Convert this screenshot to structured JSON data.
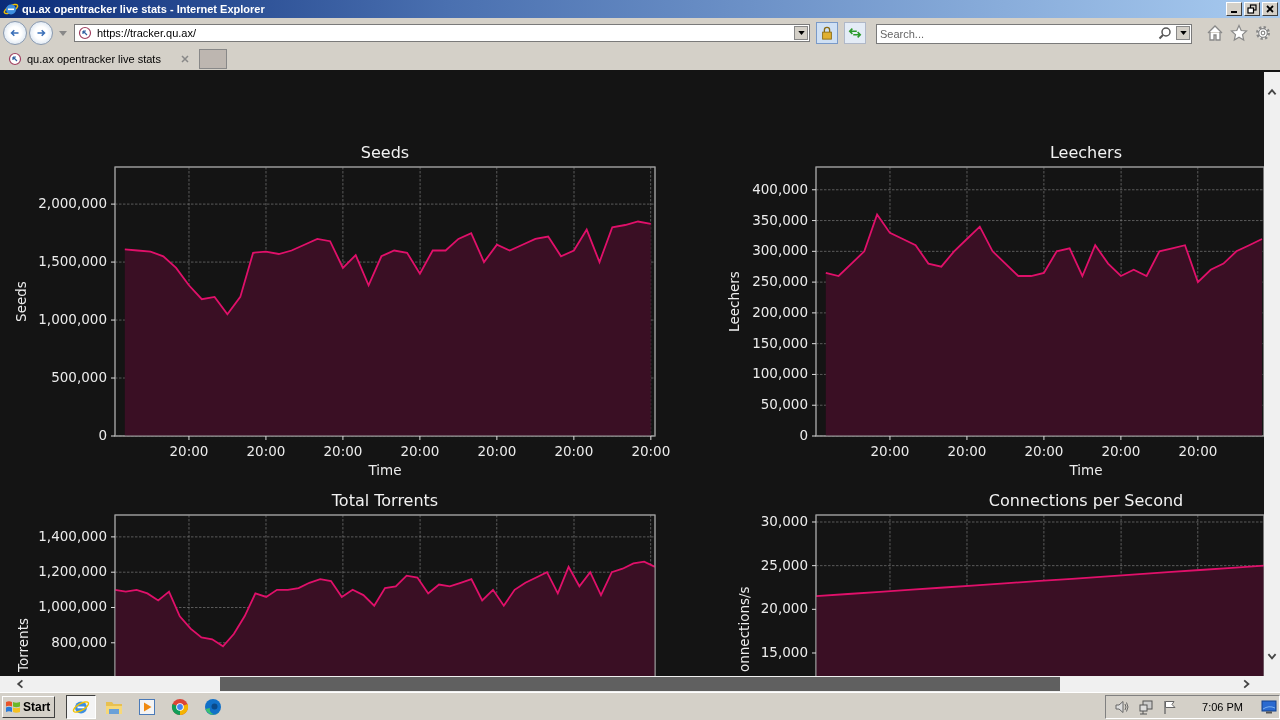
{
  "window": {
    "title": "qu.ax opentracker live stats - Internet Explorer"
  },
  "address_bar": {
    "url": "https://tracker.qu.ax/"
  },
  "search": {
    "placeholder": "Search..."
  },
  "tabs": [
    {
      "label": "qu.ax opentracker live stats",
      "selected": true
    }
  ],
  "panels": [
    {
      "chart_data": {
        "type": "area",
        "title": "Seeds",
        "xlabel": "Time",
        "ylabel": "Seeds",
        "grid": true,
        "ylim": [
          0,
          2320000
        ],
        "categories": [
          null,
          null,
          null,
          null,
          null,
          "20:00",
          null,
          null,
          null,
          null,
          null,
          "20:00",
          null,
          null,
          null,
          null,
          null,
          "20:00",
          null,
          null,
          null,
          null,
          null,
          "20:00",
          null,
          null,
          null,
          null,
          null,
          "20:00",
          null,
          null,
          null,
          null,
          null,
          "20:00",
          null,
          null,
          null,
          null,
          null,
          "20:00"
        ],
        "series": [
          {
            "color": "#e0106a",
            "values": [
              1610000,
              1600000,
              1590000,
              1550000,
              1450000,
              1300000,
              1180000,
              1200000,
              1050000,
              1200000,
              1580000,
              1590000,
              1570000,
              1600000,
              1650000,
              1700000,
              1680000,
              1450000,
              1560000,
              1300000,
              1550000,
              1600000,
              1580000,
              1400000,
              1600000,
              1600000,
              1700000,
              1750000,
              1500000,
              1650000,
              1600000,
              1650000,
              1700000,
              1720000,
              1550000,
              1600000,
              1780000,
              1500000,
              1800000,
              1820000,
              1850000,
              1830000
            ]
          }
        ],
        "yticks": [
          {
            "value": 0,
            "label": "0"
          },
          {
            "value": 500000,
            "label": "500,000"
          },
          {
            "value": 1000000,
            "label": "1,000,000"
          },
          {
            "value": 1500000,
            "label": "1,500,000"
          },
          {
            "value": 2000000,
            "label": "2,000,000"
          }
        ]
      }
    },
    {
      "chart_data": {
        "type": "area",
        "title": "Leechers",
        "xlabel": "Time",
        "ylabel": "Leechers",
        "grid": true,
        "ylim": [
          0,
          437000
        ],
        "categories": [
          null,
          null,
          null,
          null,
          null,
          "20:00",
          null,
          null,
          null,
          null,
          null,
          "20:00",
          null,
          null,
          null,
          null,
          null,
          "20:00",
          null,
          null,
          null,
          null,
          null,
          "20:00",
          null,
          null,
          null,
          null,
          null,
          "20:00",
          null,
          null,
          null,
          null,
          null
        ],
        "series": [
          {
            "color": "#e0106a",
            "values": [
              265000,
              260000,
              280000,
              300000,
              360000,
              330000,
              320000,
              310000,
              280000,
              275000,
              300000,
              320000,
              340000,
              300000,
              280000,
              260000,
              260000,
              265000,
              300000,
              305000,
              260000,
              310000,
              280000,
              260000,
              270000,
              260000,
              300000,
              305000,
              310000,
              250000,
              270000,
              280000,
              300000,
              310000,
              320000
            ]
          }
        ],
        "yticks": [
          {
            "value": 0,
            "label": "0"
          },
          {
            "value": 50000,
            "label": "50,000"
          },
          {
            "value": 100000,
            "label": "100,000"
          },
          {
            "value": 150000,
            "label": "150,000"
          },
          {
            "value": 200000,
            "label": "200,000"
          },
          {
            "value": 250000,
            "label": "250,000"
          },
          {
            "value": 300000,
            "label": "300,000"
          },
          {
            "value": 350000,
            "label": "350,000"
          },
          {
            "value": 400000,
            "label": "400,000"
          }
        ]
      }
    },
    {
      "chart_data": {
        "type": "area",
        "title": "Total Torrents",
        "ylabel": "Torrents",
        "grid": true,
        "ylim": [
          0,
          1524000
        ],
        "categories": [
          null,
          null,
          null,
          null,
          null,
          null,
          null,
          null,
          null,
          null,
          null,
          null,
          null,
          null,
          null,
          null,
          null,
          null,
          null,
          null,
          null,
          null,
          null,
          null,
          null,
          null,
          null,
          null,
          null,
          null,
          null,
          null,
          null,
          null,
          null,
          null,
          null,
          null,
          null,
          null,
          null,
          null,
          null,
          null,
          null,
          null,
          null,
          null,
          null,
          null,
          null
        ],
        "series": [
          {
            "color": "#e0106a",
            "values": [
              1100000,
              1090000,
              1100000,
              1080000,
              1040000,
              1090000,
              950000,
              880000,
              830000,
              820000,
              780000,
              850000,
              950000,
              1080000,
              1060000,
              1100000,
              1100000,
              1110000,
              1140000,
              1160000,
              1150000,
              1060000,
              1100000,
              1070000,
              1010000,
              1110000,
              1120000,
              1180000,
              1170000,
              1080000,
              1130000,
              1120000,
              1140000,
              1160000,
              1040000,
              1100000,
              1010000,
              1100000,
              1140000,
              1170000,
              1200000,
              1080000,
              1230000,
              1120000,
              1200000,
              1070000,
              1200000,
              1220000,
              1250000,
              1260000,
              1230000
            ]
          }
        ],
        "yticks": [
          {
            "value": 800000,
            "label": "800,000"
          },
          {
            "value": 1000000,
            "label": "1,000,000"
          },
          {
            "value": 1200000,
            "label": "1,200,000"
          },
          {
            "value": 1400000,
            "label": "1,400,000"
          }
        ]
      }
    },
    {
      "chart_data": {
        "type": "area",
        "title": "Connections per Second",
        "ylabel": "onnections/s",
        "grid": true,
        "ylim": [
          0,
          30800
        ],
        "categories": [
          null,
          null,
          null,
          null,
          null,
          null,
          null,
          null,
          null,
          null,
          null,
          null,
          null,
          null,
          null
        ],
        "series": [
          {
            "color": "#e0106a",
            "values": [
              21500,
              21750,
              22000,
              22250,
              22500,
              22750,
              23000,
              23250,
              23500,
              23750,
              24000,
              24250,
              24500,
              24750,
              25000
            ]
          }
        ],
        "yticks": [
          {
            "value": 15000,
            "label": "15,000"
          },
          {
            "value": 20000,
            "label": "20,000"
          },
          {
            "value": 25000,
            "label": "25,000"
          },
          {
            "value": 30000,
            "label": "30,000"
          }
        ]
      }
    }
  ],
  "taskbar": {
    "start_button": "Start",
    "clock": "7:06 PM",
    "apps": [
      {
        "kind": "ie",
        "selected": true
      },
      {
        "kind": "folder",
        "selected": false
      },
      {
        "kind": "media",
        "selected": false
      },
      {
        "kind": "chrome",
        "selected": false
      },
      {
        "kind": "edge",
        "selected": false
      }
    ]
  }
}
